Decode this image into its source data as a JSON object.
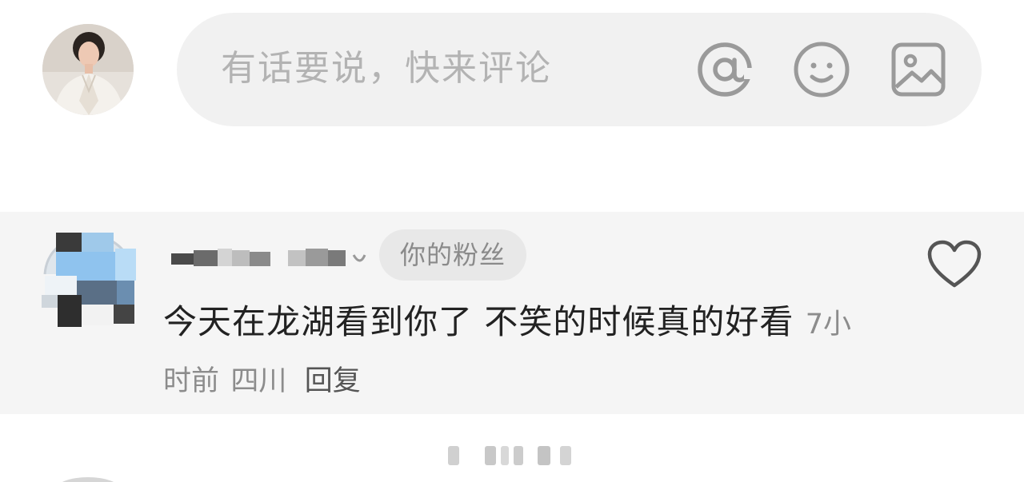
{
  "composer": {
    "placeholder": "有话要说，快来评论",
    "icons": [
      "at-icon",
      "emoji-icon",
      "image-icon"
    ]
  },
  "comment": {
    "badge": "你的粉丝",
    "text": "今天在龙湖看到你了 不笑的时候真的好看",
    "time": "7小时前",
    "location": "四川",
    "reply_label": "回复",
    "like_icon": "heart-icon"
  },
  "colors": {
    "input_background": "#f1f1f1",
    "comment_background": "#f5f5f5",
    "placeholder_text": "#b3b3b3",
    "icon_gray": "#9a9a9a",
    "meta_text": "#8c8c8c",
    "badge_background": "#e8e8e8"
  }
}
